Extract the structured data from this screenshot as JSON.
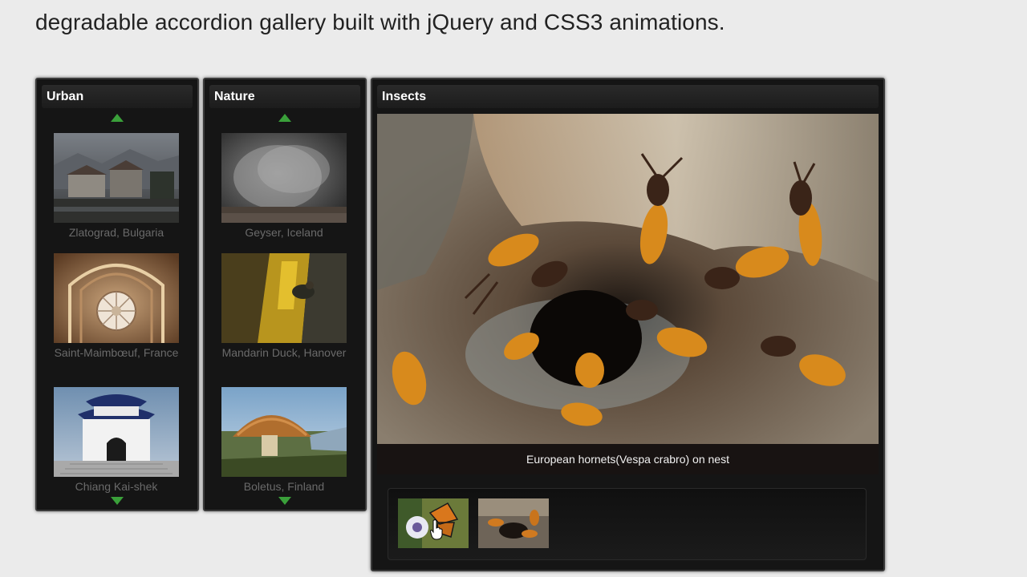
{
  "headline": "degradable accordion gallery built with jQuery and CSS3 animations.",
  "panels": {
    "urban": {
      "title": "Urban",
      "items": [
        {
          "caption": "Zlatograd, Bulgaria"
        },
        {
          "caption": "Saint-Maimbœuf, France"
        },
        {
          "caption": "Chiang Kai-shek"
        }
      ]
    },
    "nature": {
      "title": "Nature",
      "items": [
        {
          "caption": "Geyser, Iceland"
        },
        {
          "caption": "Mandarin Duck, Hanover"
        },
        {
          "caption": "Boletus, Finland"
        }
      ]
    },
    "insects": {
      "title": "Insects",
      "image_caption": "European hornets(Vespa crabro) on nest"
    }
  },
  "colors": {
    "accent_arrow": "#3aa03a",
    "panel_bg": "#151515",
    "page_bg": "#ebebeb"
  },
  "icons": [
    "arrow-up-icon",
    "arrow-down-icon",
    "hand-cursor-icon"
  ]
}
